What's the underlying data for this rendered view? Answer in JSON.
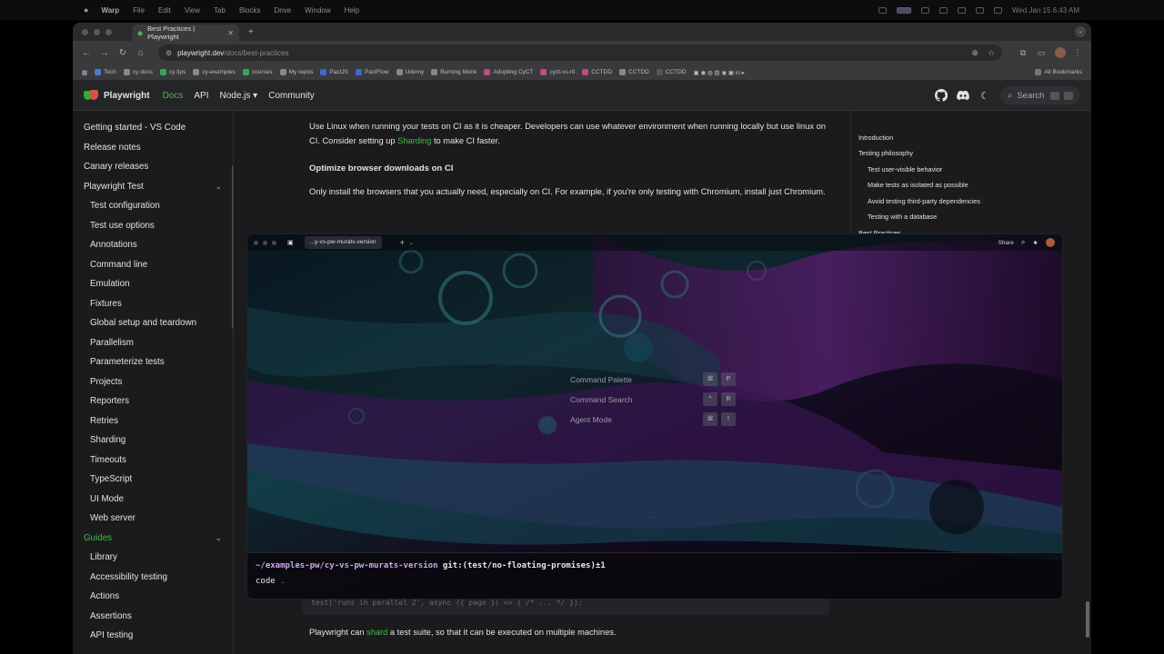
{
  "menubar": {
    "items": [
      "Warp",
      "File",
      "Edit",
      "View",
      "Tab",
      "Blocks",
      "Drive",
      "Window",
      "Help"
    ],
    "clock": "Wed Jan 15  6:43 AM"
  },
  "browser": {
    "tab_title": "Best Practices | Playwright",
    "new_tab": "+",
    "url_host": "playwright.dev",
    "url_path": "/docs/best-practices",
    "bookmarks": [
      {
        "label": "Tech",
        "color": "#4a7bd0"
      },
      {
        "label": "cy docs",
        "color": "#888888"
      },
      {
        "label": "cy tips",
        "color": "#3aa35a"
      },
      {
        "label": "cy-examples",
        "color": "#888888"
      },
      {
        "label": "courses",
        "color": "#3aa35a"
      },
      {
        "label": "My repos",
        "color": "#888888"
      },
      {
        "label": "PactJS",
        "color": "#3a6ad0"
      },
      {
        "label": "PactFlow",
        "color": "#3a6ad0"
      },
      {
        "label": "Udemy",
        "color": "#888888"
      },
      {
        "label": "Burning Monk",
        "color": "#888888"
      },
      {
        "label": "Adopting CyCT",
        "color": "#c04a8a"
      },
      {
        "label": "cyct-vs-rtl",
        "color": "#c04a8a"
      },
      {
        "label": "CCTDD",
        "color": "#c04a8a"
      },
      {
        "label": "CCTDD",
        "color": "#888888"
      },
      {
        "label": "CCTDD",
        "color": "#555555"
      }
    ],
    "all_bookmarks": "All Bookmarks"
  },
  "pw_nav": {
    "brand": "Playwright",
    "links": [
      "Docs",
      "API",
      "Node.js ▾",
      "Community"
    ],
    "search_placeholder": "Search"
  },
  "sidebar": {
    "items": [
      {
        "label": "Getting started - VS Code",
        "sub": false
      },
      {
        "label": "Release notes",
        "sub": false
      },
      {
        "label": "Canary releases",
        "sub": false
      },
      {
        "label": "Playwright Test",
        "sub": false,
        "chevron": true
      },
      {
        "label": "Test configuration",
        "sub": true
      },
      {
        "label": "Test use options",
        "sub": true
      },
      {
        "label": "Annotations",
        "sub": true
      },
      {
        "label": "Command line",
        "sub": true
      },
      {
        "label": "Emulation",
        "sub": true
      },
      {
        "label": "Fixtures",
        "sub": true
      },
      {
        "label": "Global setup and teardown",
        "sub": true
      },
      {
        "label": "Parallelism",
        "sub": true
      },
      {
        "label": "Parameterize tests",
        "sub": true
      },
      {
        "label": "Projects",
        "sub": true
      },
      {
        "label": "Reporters",
        "sub": true
      },
      {
        "label": "Retries",
        "sub": true
      },
      {
        "label": "Sharding",
        "sub": true
      },
      {
        "label": "Timeouts",
        "sub": true
      },
      {
        "label": "TypeScript",
        "sub": true
      },
      {
        "label": "UI Mode",
        "sub": true
      },
      {
        "label": "Web server",
        "sub": true
      },
      {
        "label": "Guides",
        "sub": false,
        "chevron": true,
        "green": true
      },
      {
        "label": "Library",
        "sub": true
      },
      {
        "label": "Accessibility testing",
        "sub": true
      },
      {
        "label": "Actions",
        "sub": true
      },
      {
        "label": "Assertions",
        "sub": true
      },
      {
        "label": "API testing",
        "sub": true
      }
    ]
  },
  "article": {
    "p1_before": "Use Linux when running your tests on CI as it is cheaper. Developers can use whatever environment when running locally but use linux on CI. Consider setting up ",
    "p1_link": "Sharding",
    "p1_after": " to make CI faster.",
    "heading": "Optimize browser downloads on CI",
    "p2": "Only install the browsers that you actually need, especially on CI. For example, if you're only testing with Chromium, install just Chromium.",
    "code_ghost": "test('runs in parallel 2', async ({ page }) => { /* ... */ });",
    "p3_before": "Playwright can ",
    "p3_link": "shard",
    "p3_after": " a test suite, so that it can be executed on multiple machines."
  },
  "toc": {
    "items": [
      {
        "label": "Introduction",
        "sub": false
      },
      {
        "label": "Testing philosophy",
        "sub": false
      },
      {
        "label": "Test user-visible behavior",
        "sub": true
      },
      {
        "label": "Make tests as isolated as possible",
        "sub": true
      },
      {
        "label": "Avoid testing third-party dependencies",
        "sub": true
      },
      {
        "label": "Testing with a database",
        "sub": true
      },
      {
        "label": "Best Practices",
        "sub": false
      }
    ]
  },
  "warp": {
    "tab_title": "...y-vs-pw-murats-version",
    "share": "Share",
    "palette": [
      {
        "label": "Command Palette",
        "k1": "⌘",
        "k2": "P"
      },
      {
        "label": "Command Search",
        "k1": "^",
        "k2": "R"
      },
      {
        "label": "Agent Mode",
        "k1": "⌘",
        "k2": "I"
      }
    ],
    "dots": "...",
    "prompt_path": "~/examples-pw/cy-vs-pw-murats-version",
    "prompt_git": " git:(test/no-floating-promises)±1",
    "command": "code",
    "command_arg": " ."
  }
}
